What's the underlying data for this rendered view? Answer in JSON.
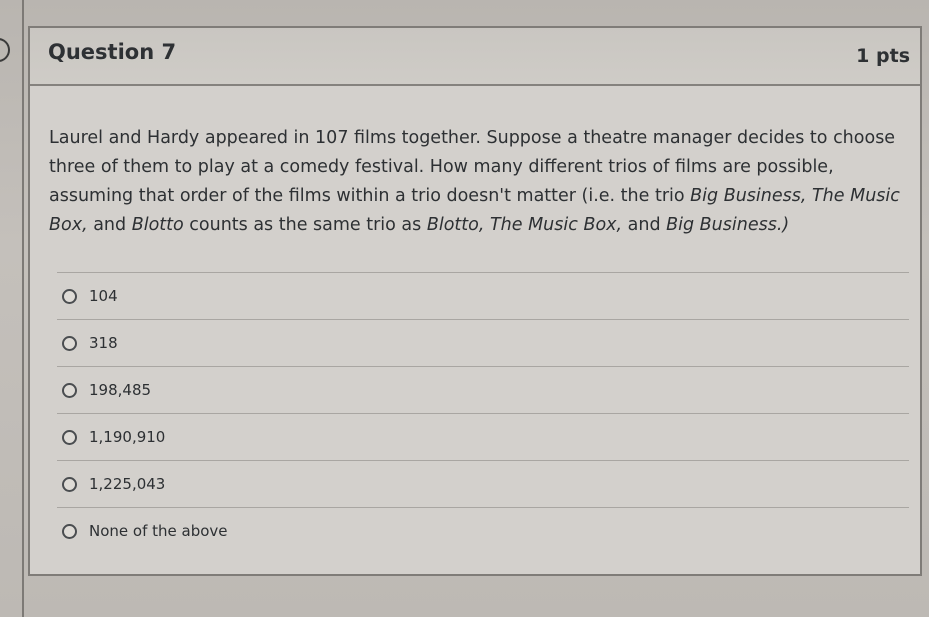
{
  "question": {
    "title": "Question 7",
    "points": "1 pts",
    "text_parts": [
      "Laurel and Hardy appeared in 107 films together. Suppose a theatre manager decides to choose three of them to play at a comedy festival. How many different trios of films are possible, assuming that order of the films within a trio doesn't matter (i.e. the trio ",
      "Big Business, The Music Box,",
      " and ",
      "Blotto",
      " counts as the same trio as ",
      "Blotto, The Music Box,",
      " and ",
      "Big Business.)"
    ]
  },
  "answers": [
    {
      "label": "104"
    },
    {
      "label": "318"
    },
    {
      "label": "198,485"
    },
    {
      "label": "1,190,910"
    },
    {
      "label": "1,225,043"
    },
    {
      "label": "None of the above"
    }
  ]
}
